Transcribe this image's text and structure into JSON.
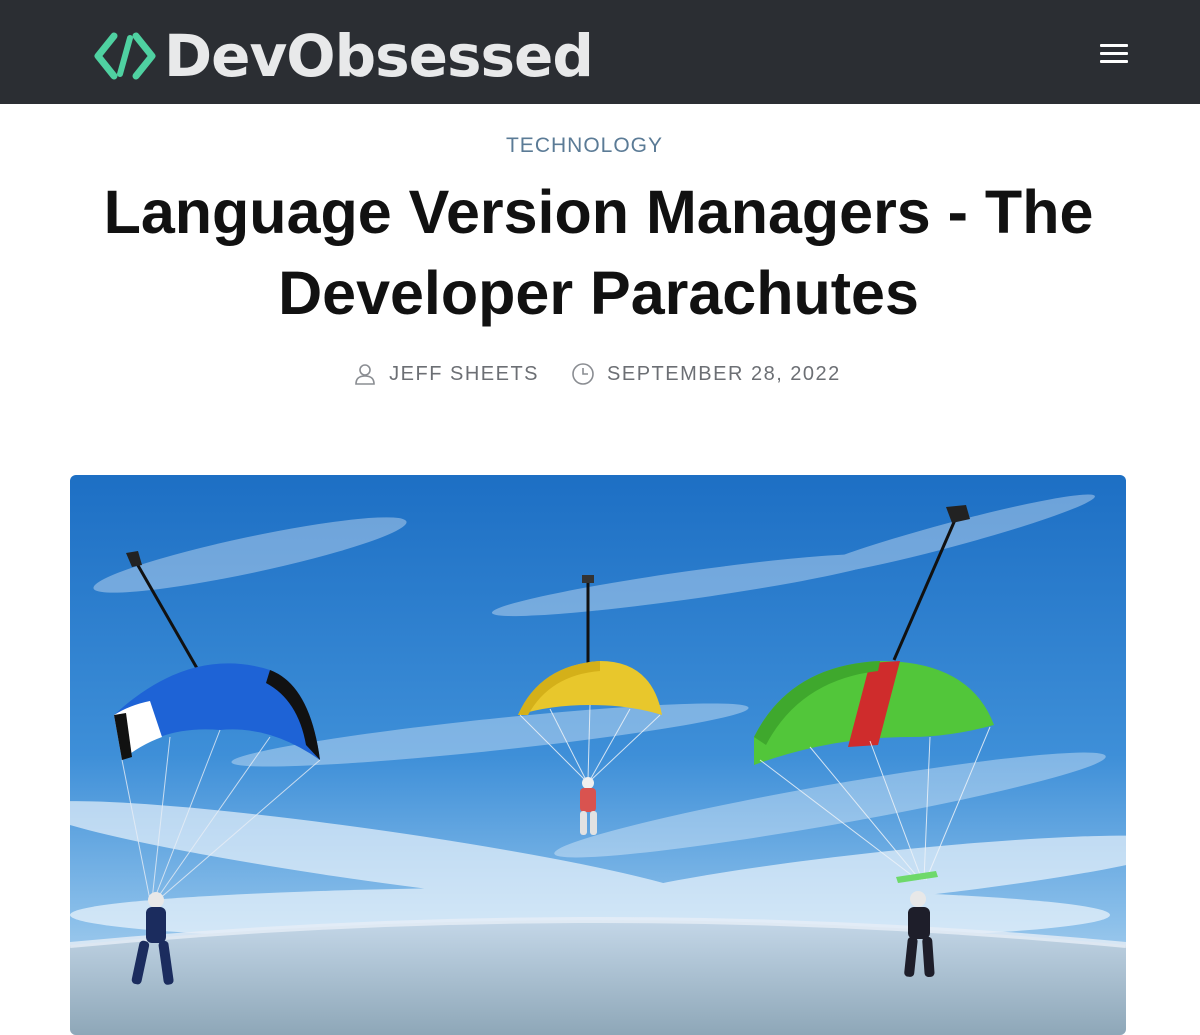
{
  "site": {
    "name": "DevObsessed",
    "logo_icon": "code-brackets-icon",
    "accent_color": "#4fd1a1"
  },
  "nav": {
    "menu_icon": "hamburger-menu-icon"
  },
  "article": {
    "category": "TECHNOLOGY",
    "title": "Language Version Managers - The Developer Parachutes",
    "author": "JEFF SHEETS",
    "author_icon": "user-icon",
    "date": "SEPTEMBER 28, 2022",
    "date_icon": "clock-icon"
  },
  "hero_image": {
    "subject": "three-parachutes-in-blue-sky",
    "canopy_colors": [
      "#1e63d6",
      "#e8c72c",
      "#52c63a"
    ]
  }
}
